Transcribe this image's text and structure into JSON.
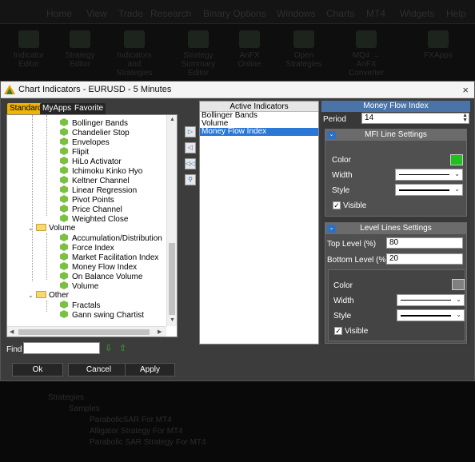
{
  "background": {
    "menu": [
      "Home",
      "View",
      "Trade",
      "Research",
      "Binary Options",
      "Windows",
      "Charts",
      "MT4",
      "Widgets",
      "Help"
    ],
    "ribbon": [
      "Indicator Editor",
      "Strategy Editor",
      "Indicators and Strategies",
      "Strategy Summary Editor",
      "AnFX Online",
      "Open Strategies",
      "MQ4 → AnFX Converter",
      "FXApps"
    ],
    "tree": [
      "Strategies",
      "Samples",
      "ParabolicSAR For MT4",
      "Alligator Strategy For MT4",
      "Parabolic SAR Strategy For MT4"
    ]
  },
  "dialog": {
    "title": "Chart Indicators - EURUSD - 5 Minutes",
    "close": "×",
    "tabs": [
      "Standard",
      "MyApps",
      "Favorite"
    ],
    "tree": {
      "items": [
        "Bollinger Bands",
        "Chandelier Stop",
        "Envelopes",
        "Flipit",
        "HiLo Activator",
        "Ichimoku Kinko Hyo",
        "Keltner Channel",
        "Linear Regression",
        "Pivot Points",
        "Price Channel",
        "Weighted Close"
      ],
      "volume_folder": "Volume",
      "volume_items": [
        "Accumulation/Distribution",
        "Force Index",
        "Market Facilitation Index",
        "Money Flow Index",
        "On Balance Volume",
        "Volume"
      ],
      "other_folder": "Other",
      "other_items": [
        "Fractals",
        "Gann swing Chartist"
      ]
    },
    "active": {
      "header": "Active Indicators",
      "items": [
        "Bollinger Bands",
        "Volume",
        "Money Flow Index"
      ],
      "selected": "Money Flow Index"
    },
    "props": {
      "header": "Money Flow Index",
      "period_label": "Period",
      "period_value": "14",
      "mfi": {
        "title": "MFI Line Settings",
        "color_label": "Color",
        "color": "#1ec21e",
        "width_label": "Width",
        "style_label": "Style",
        "visible_label": "Visible"
      },
      "levels": {
        "title": "Level Lines Settings",
        "top_label": "Top Level (%)",
        "top_value": "80",
        "bottom_label": "Bottom Level (%)",
        "bottom_value": "20",
        "color_label": "Color",
        "color": "#808080",
        "width_label": "Width",
        "style_label": "Style",
        "visible_label": "Visible"
      }
    },
    "find_label": "Find",
    "buttons": {
      "ok": "Ok",
      "cancel": "Cancel",
      "apply": "Apply"
    }
  }
}
